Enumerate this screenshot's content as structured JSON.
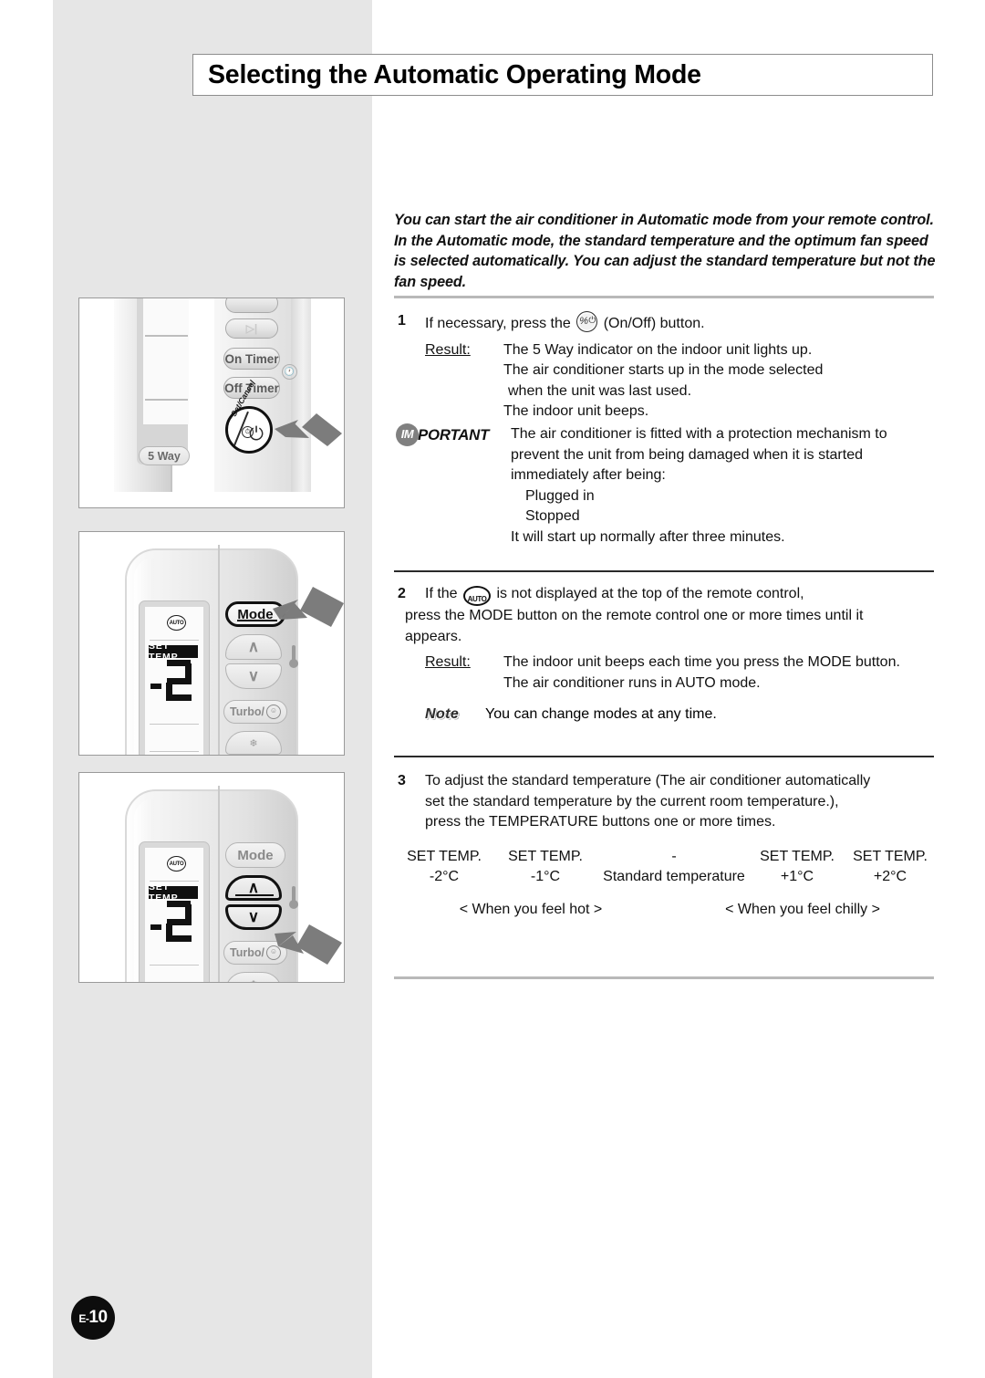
{
  "page": {
    "title": "Selecting the Automatic Operating Mode",
    "page_number_prefix": "E-",
    "page_number": "10"
  },
  "intro": "You can start the air conditioner in Automatic mode from your remote control. In the Automatic mode, the standard temperature and the optimum fan speed is selected automatically. You can adjust the standard temperature but not the fan speed.",
  "step1": {
    "number": "1",
    "text_before_icon": "If necessary, press the",
    "icon": "onoff-button-icon",
    "text_after_icon": "(On/Off) button.",
    "result_label": "Result:",
    "result_lines": [
      "The 5 Way indicator on the indoor unit lights up.",
      "The air conditioner starts up in the mode selected",
      "when the unit was last used.",
      "The indoor unit beeps."
    ]
  },
  "important": {
    "badge_circle": "IM",
    "badge_word": "PORTANT",
    "lines": [
      "The air conditioner is fitted with a protection mechanism to",
      "prevent the unit from being damaged when it is started",
      "immediately after being:"
    ],
    "bullets": [
      "Plugged in",
      "Stopped"
    ],
    "closing": "It will start up normally after three minutes."
  },
  "step2": {
    "number": "2",
    "text_before_icon": "If the",
    "icon": "auto-mode-icon",
    "text_after_icon": "is not displayed at the top of the remote control,",
    "line2": "press the MODE button on the remote control one or more times until it",
    "line3": "appears.",
    "result_label": "Result:",
    "result_lines": [
      "The indoor unit beeps each time you press the MODE button.",
      "The air conditioner runs in AUTO mode."
    ],
    "note_label": "Note",
    "note_text": "You can change modes at any time."
  },
  "step3": {
    "number": "3",
    "lines": [
      "To adjust the standard temperature (The air conditioner automatically",
      "set the standard temperature by the current room temperature.),",
      "press the TEMPERATURE buttons one or more times."
    ]
  },
  "temp_scale": {
    "headers": [
      "SET TEMP.",
      "SET TEMP.",
      "-",
      "SET TEMP.",
      "SET TEMP."
    ],
    "values": [
      "-2°C",
      "-1°C",
      "Standard temperature",
      "+1°C",
      "+2°C"
    ],
    "feel_left": "< When you feel hot >",
    "feel_right": "< When you feel chilly >"
  },
  "figures": {
    "fig1": {
      "name": "remote-top-power-button",
      "buttons": {
        "fan": "",
        "swing": "",
        "on_timer": "On Timer",
        "off_timer": "Off Timer",
        "five_way": "5 Way",
        "set_cancel": "Set/Cancel"
      },
      "callout": "arrow-pointing-to-power-button"
    },
    "fig2": {
      "name": "remote-mode-button",
      "lcd": {
        "auto_icon": "AUTO",
        "set_temp_label": "SET TEMP",
        "digit": "2",
        "minus": "-"
      },
      "buttons": {
        "mode": "Mode",
        "up": "∧",
        "down": "∨",
        "turbo": "Turbo/"
      },
      "callout": "arrow-pointing-to-mode-button"
    },
    "fig3": {
      "name": "remote-temperature-buttons",
      "lcd": {
        "auto_icon": "AUTO",
        "set_temp_label": "SET TEMP",
        "digit": "2",
        "minus": "-"
      },
      "buttons": {
        "mode": "Mode",
        "up": "∧",
        "down": "∨",
        "turbo": "Turbo/"
      },
      "callout": "arrow-pointing-to-temperature-buttons"
    }
  },
  "colors": {
    "sidebar_gray": "#e6e6e6",
    "rule_gray": "#b9b9b9",
    "rule_dark": "#2a2a2a",
    "important_badge": "#808080",
    "page_badge": "#0d0d0d"
  }
}
